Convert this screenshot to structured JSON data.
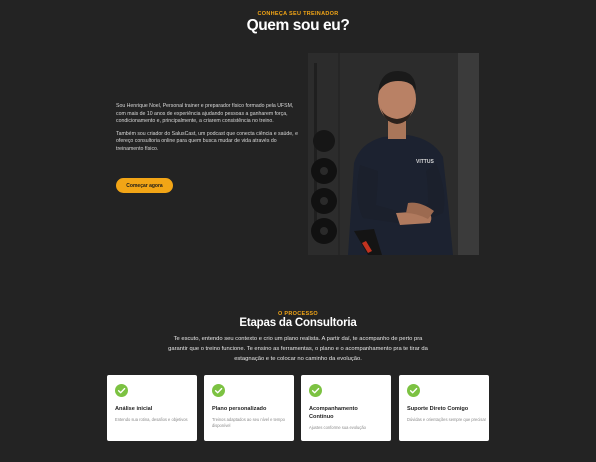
{
  "trainer": {
    "eyebrow": "CONHEÇA SEU TREINADOR",
    "title": "Quem sou eu?",
    "paragraph1": "Sou Henrique Noel, Personal trainer e preparador físico formado pela UFSM, com mais de 10 anos de experiência ajudando pessoas a ganharem força, condicionamento e, principalmente, a criarem consistência no treino.",
    "paragraph2": "Também sou criador do SalusCast, um podcast que conecta ciência e saúde, e ofereço consultoria online para quem busca mudar de vida através do treinamento físico.",
    "cta_label": "Começar agora",
    "accent_color": "#f2a516",
    "shirt_text": "VITTUS"
  },
  "process": {
    "eyebrow": "O PROCESSO",
    "title": "Etapas da Consultoria",
    "lead": "Te escuto, entendo seu contexto e crio um plano realista. A partir daí, te acompanho de perto pra garantir que o treino funcione. Te ensino as ferramentas, o plano e o acompanhamento pra te tirar da estagnação e te colocar no caminho da evolução.",
    "check_color": "#7cc242",
    "steps": [
      {
        "title": "Análise inicial",
        "desc": "Entendo sua rotina, desafios e objetivos"
      },
      {
        "title": "Plano personalizado",
        "desc": "Treinos adaptados ao seu nível e tempo disponível"
      },
      {
        "title": "Acompanhamento Contínuo",
        "desc": "Ajustes conforme sua evolução"
      },
      {
        "title": "Suporte Direto Comigo",
        "desc": "Dúvidas e orientações sempre que precisar"
      }
    ]
  }
}
